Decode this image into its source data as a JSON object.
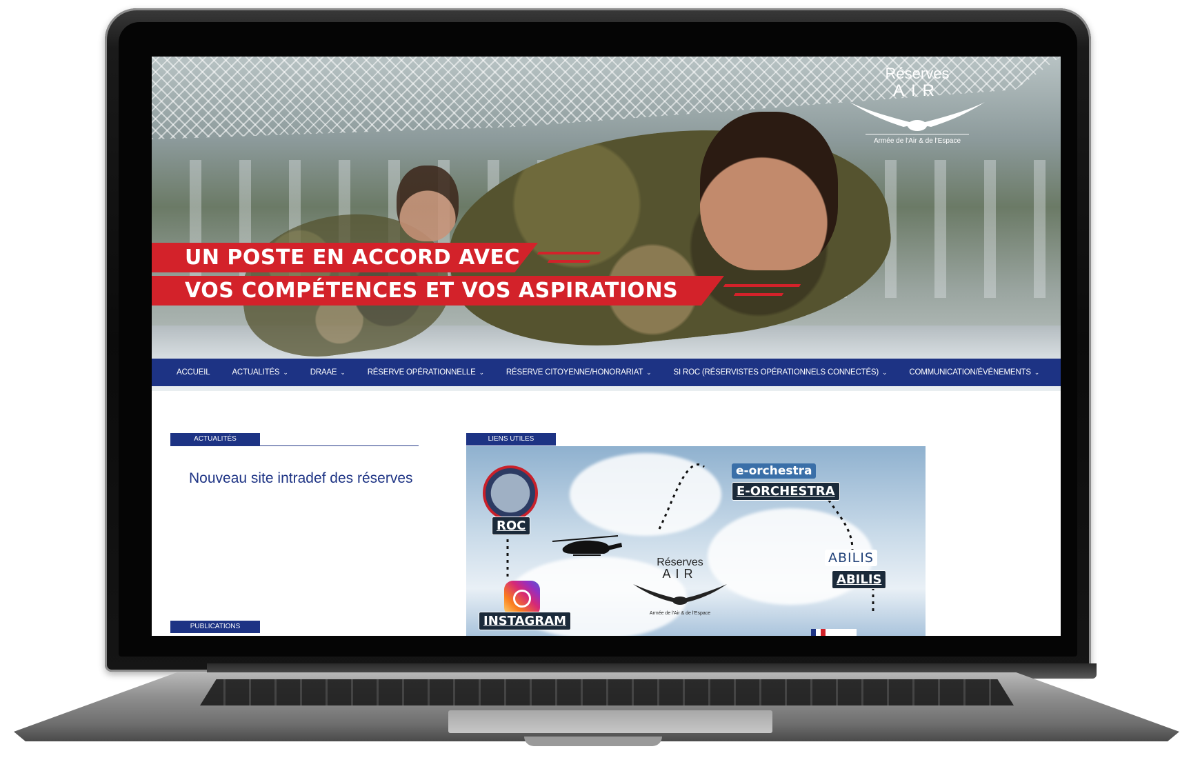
{
  "hero": {
    "banner_line_1": "UN POSTE EN ACCORD AVEC",
    "banner_line_2": "VOS COMPÉTENCES ET VOS ASPIRATIONS",
    "logo": {
      "line1": "Réserves",
      "line2": "AIR",
      "line3": "Armée de l'Air & de l'Espace"
    }
  },
  "nav": {
    "items": [
      {
        "label": "ACCUEIL",
        "has_dropdown": false
      },
      {
        "label": "ACTUALITÉS",
        "has_dropdown": true
      },
      {
        "label": "DRAAE",
        "has_dropdown": true
      },
      {
        "label": "RÉSERVE OPÉRATIONNELLE",
        "has_dropdown": true
      },
      {
        "label": "RÉSERVE CITOYENNE/HONORARIAT",
        "has_dropdown": true
      },
      {
        "label": "SI ROC (RÉSERVISTES OPÉRATIONNELS CONNECTÉS)",
        "has_dropdown": true
      },
      {
        "label": "COMMUNICATION/ÉVÉNEMENTS",
        "has_dropdown": true
      }
    ],
    "chevron_icon": "chevron-down-icon"
  },
  "sections": {
    "actualites_tag": "ACTUALITÉS",
    "liens_tag": "LIENS UTILES",
    "publications_tag": "PUBLICATIONS",
    "news_title": "Nouveau site intradef des réserves"
  },
  "links": {
    "roc": "ROC",
    "orchestra_logo": "e-orchestra",
    "orchestra": "E-ORCHESTRA",
    "abilis_logo": "ABILIS",
    "abilis": "ABILIS",
    "instagram": "INSTAGRAM",
    "center_logo": {
      "line1": "Réserves",
      "line2": "AIR",
      "line3": "Armée de l'Air & de l'Espace"
    }
  },
  "colors": {
    "nav_blue": "#1d3384",
    "banner_red": "#d3222a"
  }
}
